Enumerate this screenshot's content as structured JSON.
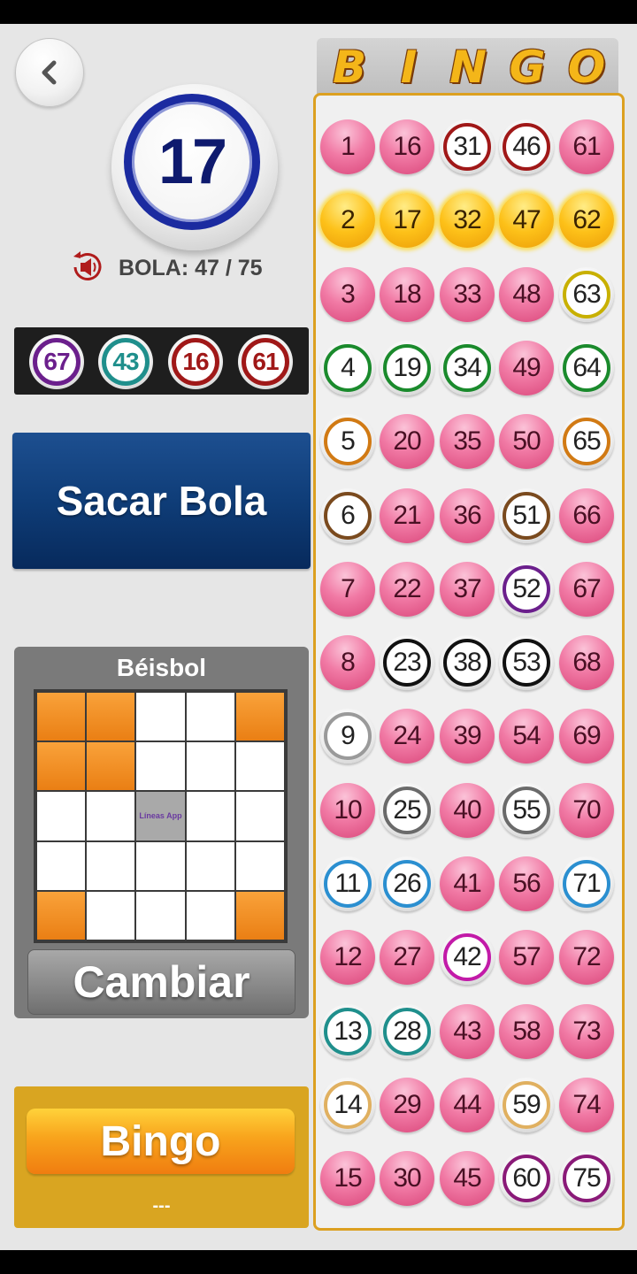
{
  "current_ball": {
    "number": "17"
  },
  "counter": {
    "label": "BOLA: 47 / 75"
  },
  "history": [
    {
      "number": "67",
      "color": "#6b1f8c"
    },
    {
      "number": "43",
      "color": "#1f8f8c"
    },
    {
      "number": "16",
      "color": "#a01818"
    },
    {
      "number": "61",
      "color": "#a01818"
    }
  ],
  "actions": {
    "draw_label": "Sacar Bola",
    "change_label": "Cambiar",
    "bingo_label": "Bingo",
    "bingo_status": "---"
  },
  "pattern": {
    "name": "Béisbol",
    "cells": [
      [
        1,
        1,
        0,
        0,
        1
      ],
      [
        1,
        1,
        0,
        0,
        0
      ],
      [
        0,
        0,
        2,
        0,
        0
      ],
      [
        0,
        0,
        0,
        0,
        0
      ],
      [
        1,
        0,
        0,
        0,
        1
      ]
    ],
    "center_logo": "Líneas App"
  },
  "board": {
    "header": [
      "B",
      "I",
      "N",
      "G",
      "O"
    ],
    "rows": [
      [
        {
          "n": "1",
          "s": "pink"
        },
        {
          "n": "16",
          "s": "pink"
        },
        {
          "n": "31",
          "s": "called",
          "c": "#a01818"
        },
        {
          "n": "46",
          "s": "called",
          "c": "#a01818"
        },
        {
          "n": "61",
          "s": "pink"
        }
      ],
      [
        {
          "n": "2",
          "s": "yellow"
        },
        {
          "n": "17",
          "s": "yellow"
        },
        {
          "n": "32",
          "s": "yellow"
        },
        {
          "n": "47",
          "s": "yellow"
        },
        {
          "n": "62",
          "s": "yellow"
        }
      ],
      [
        {
          "n": "3",
          "s": "pink"
        },
        {
          "n": "18",
          "s": "pink"
        },
        {
          "n": "33",
          "s": "pink"
        },
        {
          "n": "48",
          "s": "pink"
        },
        {
          "n": "63",
          "s": "called",
          "c": "#c8b000"
        }
      ],
      [
        {
          "n": "4",
          "s": "called",
          "c": "#1a8a2c"
        },
        {
          "n": "19",
          "s": "called",
          "c": "#1a8a2c"
        },
        {
          "n": "34",
          "s": "called",
          "c": "#1a8a2c"
        },
        {
          "n": "49",
          "s": "pink"
        },
        {
          "n": "64",
          "s": "called",
          "c": "#1a8a2c"
        }
      ],
      [
        {
          "n": "5",
          "s": "called",
          "c": "#d17a14"
        },
        {
          "n": "20",
          "s": "pink"
        },
        {
          "n": "35",
          "s": "pink"
        },
        {
          "n": "50",
          "s": "pink"
        },
        {
          "n": "65",
          "s": "called",
          "c": "#d17a14"
        }
      ],
      [
        {
          "n": "6",
          "s": "called",
          "c": "#7a4a1e"
        },
        {
          "n": "21",
          "s": "pink"
        },
        {
          "n": "36",
          "s": "pink"
        },
        {
          "n": "51",
          "s": "called",
          "c": "#7a4a1e"
        },
        {
          "n": "66",
          "s": "pink"
        }
      ],
      [
        {
          "n": "7",
          "s": "pink"
        },
        {
          "n": "22",
          "s": "pink"
        },
        {
          "n": "37",
          "s": "pink"
        },
        {
          "n": "52",
          "s": "called",
          "c": "#6b1f8c"
        },
        {
          "n": "67",
          "s": "pink"
        }
      ],
      [
        {
          "n": "8",
          "s": "pink"
        },
        {
          "n": "23",
          "s": "called",
          "c": "#111111"
        },
        {
          "n": "38",
          "s": "called",
          "c": "#111111"
        },
        {
          "n": "53",
          "s": "called",
          "c": "#111111"
        },
        {
          "n": "68",
          "s": "pink"
        }
      ],
      [
        {
          "n": "9",
          "s": "called",
          "c": "#9a9a9a"
        },
        {
          "n": "24",
          "s": "pink"
        },
        {
          "n": "39",
          "s": "pink"
        },
        {
          "n": "54",
          "s": "pink"
        },
        {
          "n": "69",
          "s": "pink"
        }
      ],
      [
        {
          "n": "10",
          "s": "pink"
        },
        {
          "n": "25",
          "s": "called",
          "c": "#6a6a6a"
        },
        {
          "n": "40",
          "s": "pink"
        },
        {
          "n": "55",
          "s": "called",
          "c": "#6a6a6a"
        },
        {
          "n": "70",
          "s": "pink"
        }
      ],
      [
        {
          "n": "11",
          "s": "called",
          "c": "#2b8fd0"
        },
        {
          "n": "26",
          "s": "called",
          "c": "#2b8fd0"
        },
        {
          "n": "41",
          "s": "pink"
        },
        {
          "n": "56",
          "s": "pink"
        },
        {
          "n": "71",
          "s": "called",
          "c": "#2b8fd0"
        }
      ],
      [
        {
          "n": "12",
          "s": "pink"
        },
        {
          "n": "27",
          "s": "pink"
        },
        {
          "n": "42",
          "s": "called",
          "c": "#c21aa8"
        },
        {
          "n": "57",
          "s": "pink"
        },
        {
          "n": "72",
          "s": "pink"
        }
      ],
      [
        {
          "n": "13",
          "s": "called",
          "c": "#1f8f8c"
        },
        {
          "n": "28",
          "s": "called",
          "c": "#1f8f8c"
        },
        {
          "n": "43",
          "s": "pink"
        },
        {
          "n": "58",
          "s": "pink"
        },
        {
          "n": "73",
          "s": "pink"
        }
      ],
      [
        {
          "n": "14",
          "s": "called",
          "c": "#e0b060"
        },
        {
          "n": "29",
          "s": "pink"
        },
        {
          "n": "44",
          "s": "pink"
        },
        {
          "n": "59",
          "s": "called",
          "c": "#e0b060"
        },
        {
          "n": "74",
          "s": "pink"
        }
      ],
      [
        {
          "n": "15",
          "s": "pink"
        },
        {
          "n": "30",
          "s": "pink"
        },
        {
          "n": "45",
          "s": "pink"
        },
        {
          "n": "60",
          "s": "called",
          "c": "#8a1a78"
        },
        {
          "n": "75",
          "s": "called",
          "c": "#8a1a78"
        }
      ]
    ]
  },
  "icons": {
    "back": "chevron-left-icon",
    "sound": "speaker-replay-icon"
  }
}
